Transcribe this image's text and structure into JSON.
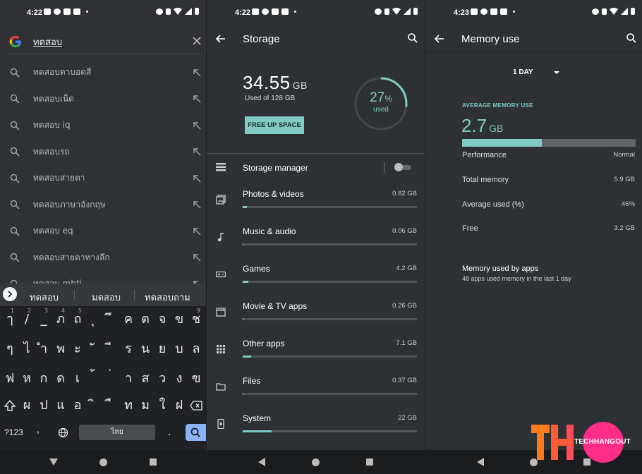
{
  "search_screen": {
    "status": {
      "time": "4:22"
    },
    "query": "ทดสอบ",
    "suggestions": [
      "ทดสอบตาบอดสี",
      "ทดสอบเน็ต",
      "ทดสอบ iq",
      "ทดสอบรถ",
      "ทดสอบสายตา",
      "ทดสอบภาษาอังกฤษ",
      "ทดสอบ eq",
      "ทดสอบสายตาทางลึก",
      "ทดสอบ mbti"
    ],
    "keyboard": {
      "word_suggestions": [
        "ทดสอบ",
        "มดสอบ",
        "ทดสอบถาม"
      ],
      "row1": [
        "ๅ",
        "/",
        "_",
        "ภ",
        "ถ",
        "ุ",
        "ึ",
        "ค",
        "ต",
        "จ",
        "ข",
        "ช"
      ],
      "row1_hints": [
        "1",
        "2",
        "3",
        "4",
        "5",
        "",
        "",
        "",
        "",
        "",
        "",
        "9"
      ],
      "row2": [
        "ๆ",
        "ไ",
        "ำ",
        "พ",
        "ะ",
        "ั",
        "ี",
        "ร",
        "น",
        "ย",
        "บ",
        "ล"
      ],
      "row3": [
        "ฟ",
        "ห",
        "ก",
        "ด",
        "เ",
        "้",
        "่",
        "า",
        "ส",
        "ว",
        "ง",
        "ฃ"
      ],
      "row4": [
        "ผ",
        "ป",
        "แ",
        "อ",
        "ิ",
        "ื",
        "ท",
        "ม",
        "ใ",
        "ฝ"
      ],
      "symbols_key": "?123",
      "comma_key": ",",
      "space_label": "ไทย",
      "period_key": "."
    }
  },
  "storage_screen": {
    "status": {
      "time": "4:22"
    },
    "title": "Storage",
    "used_value": "34.55",
    "used_unit": "GB",
    "used_of": "Used of 128 GB",
    "free_up_button": "FREE UP SPACE",
    "percent": "27",
    "percent_sign": "%",
    "percent_label": "used",
    "percent_fraction": 0.27,
    "storage_manager": "Storage manager",
    "storage_manager_on": false,
    "categories": [
      {
        "label": "Photos & videos",
        "size": "0.82 GB",
        "fraction": 0.024,
        "icon": "photos-icon"
      },
      {
        "label": "Music & audio",
        "size": "0.06 GB",
        "fraction": 0.004,
        "icon": "music-note-icon"
      },
      {
        "label": "Games",
        "size": "4.2 GB",
        "fraction": 0.033,
        "icon": "gamepad-icon"
      },
      {
        "label": "Movie & TV apps",
        "size": "0.26 GB",
        "fraction": 0.005,
        "icon": "clapperboard-icon"
      },
      {
        "label": "Other apps",
        "size": "7.1 GB",
        "fraction": 0.05,
        "icon": "apps-grid-icon"
      },
      {
        "label": "Files",
        "size": "0.37 GB",
        "fraction": 0.005,
        "icon": "folder-icon"
      },
      {
        "label": "System",
        "size": "22 GB",
        "fraction": 0.165,
        "icon": "phone-system-icon"
      }
    ]
  },
  "memory_screen": {
    "status": {
      "time": "4:23"
    },
    "title": "Memory use",
    "period": "1 DAY",
    "avg_label": "AVERAGE MEMORY USE",
    "avg_value": "2.7",
    "avg_unit": "GB",
    "avg_fraction": 0.46,
    "rows": [
      {
        "key": "Performance",
        "value": "Normal"
      },
      {
        "key": "Total memory",
        "value": "5.9 GB"
      },
      {
        "key": "Average used (%)",
        "value": "46%"
      },
      {
        "key": "Free",
        "value": "3.2 GB"
      }
    ],
    "apps_title": "Memory used by apps",
    "apps_sub": "48 apps used memory in the last 1 day"
  },
  "watermark": "TECHHANGOUT",
  "colors": {
    "accent": "#80cbc4",
    "logo_orange": "#ff7a1a",
    "logo_pink": "#ff2d87"
  }
}
